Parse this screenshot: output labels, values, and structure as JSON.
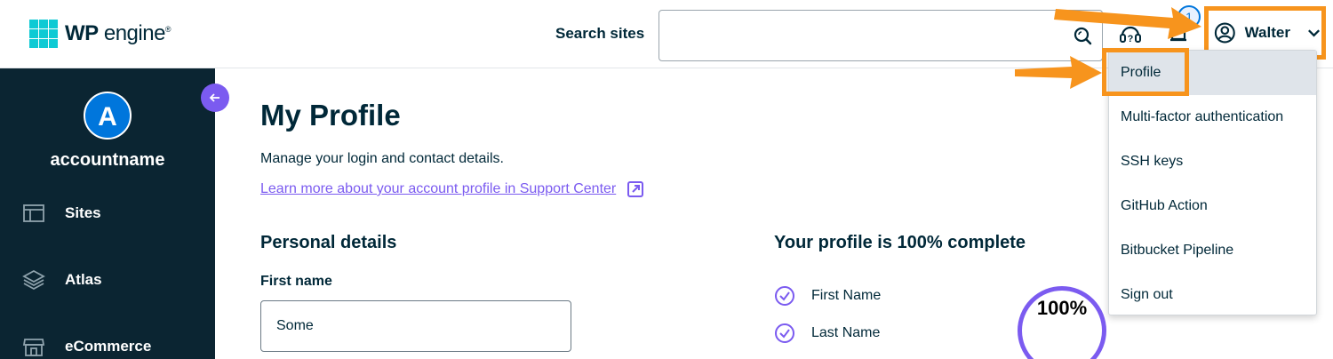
{
  "header": {
    "logo": {
      "brand_bold": "WP",
      "brand_rest": "engine",
      "reg": "®"
    },
    "search_label": "Search sites",
    "search_placeholder": "",
    "notification_count": "1",
    "user_name": "Walter"
  },
  "sidebar": {
    "account_initial": "A",
    "account_name": "accountname",
    "items": [
      {
        "label": "Sites",
        "icon": "sites-icon"
      },
      {
        "label": "Atlas",
        "icon": "layers-icon"
      },
      {
        "label": "eCommerce",
        "icon": "store-icon"
      }
    ]
  },
  "main": {
    "title": "My Profile",
    "description": "Manage your login and contact details.",
    "help_link": "Learn more about your account profile in Support Center",
    "personal_details_title": "Personal details",
    "first_name_label": "First name",
    "first_name_value": "Some",
    "completion_title": "Your profile is 100% complete",
    "checklist": [
      "First Name",
      "Last Name"
    ],
    "completion_percent": "100%"
  },
  "dropdown": {
    "items": [
      "Profile",
      "Multi-factor authentication",
      "SSH keys",
      "GitHub Action",
      "Bitbucket Pipeline",
      "Sign out"
    ],
    "active_index": 0
  },
  "colors": {
    "annotation_orange": "#f7941d",
    "accent_purple": "#7b5bf0",
    "sidebar_bg": "#0b2532",
    "logo_teal": "#0ecad4",
    "avatar_blue": "#0076dc"
  }
}
